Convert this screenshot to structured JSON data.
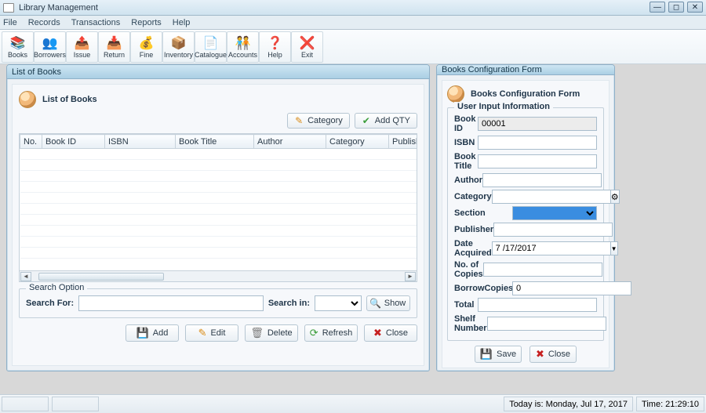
{
  "window": {
    "title": "Library Management"
  },
  "menu": [
    "File",
    "Records",
    "Transactions",
    "Reports",
    "Help"
  ],
  "toolbar": [
    {
      "label": "Books",
      "icon": "📚"
    },
    {
      "label": "Borrowers",
      "icon": "👥"
    },
    {
      "label": "Issue",
      "icon": "📤"
    },
    {
      "label": "Return",
      "icon": "📥"
    },
    {
      "label": "Fine",
      "icon": "💰"
    },
    {
      "label": "Inventory",
      "icon": "📦"
    },
    {
      "label": "Catalogue",
      "icon": "📄"
    },
    {
      "label": "Accounts",
      "icon": "🧑‍🤝‍🧑"
    },
    {
      "label": "Help",
      "icon": "❓"
    },
    {
      "label": "Exit",
      "icon": "❌"
    }
  ],
  "left_panel": {
    "mdi_title": "List of Books",
    "header": "List of Books",
    "btn_category": "Category",
    "btn_addqty": "Add QTY",
    "columns": [
      "No.",
      "Book ID",
      "ISBN",
      "Book Title",
      "Author",
      "Category",
      "Publisher"
    ],
    "rows": [],
    "search_group": "Search Option",
    "search_for": "Search For:",
    "search_in": "Search in:",
    "btn_show": "Show",
    "actions": {
      "add": "Add",
      "edit": "Edit",
      "delete": "Delete",
      "refresh": "Refresh",
      "close": "Close"
    }
  },
  "right_panel": {
    "mdi_title": "Books Configuration Form",
    "header": "Books Configuration Form",
    "group": "User Input Information",
    "fields": {
      "book_id": {
        "label": "Book ID",
        "value": "00001"
      },
      "isbn": {
        "label": "ISBN",
        "value": ""
      },
      "book_title": {
        "label": "Book Title",
        "value": ""
      },
      "author": {
        "label": "Author",
        "value": ""
      },
      "category": {
        "label": "Category",
        "value": ""
      },
      "section": {
        "label": "Section",
        "value": ""
      },
      "publisher": {
        "label": "Publisher",
        "value": ""
      },
      "date_acquired": {
        "label": "Date Acquired",
        "value": "7 /17/2017"
      },
      "copies": {
        "label": "No. of Copies",
        "value": ""
      },
      "borrow_copies": {
        "label": "BorrowCopies",
        "value": "0"
      },
      "total": {
        "label": "Total",
        "value": ""
      },
      "shelf": {
        "label": "Shelf Number",
        "value": ""
      }
    },
    "actions": {
      "save": "Save",
      "close": "Close"
    }
  },
  "status": {
    "today": "Today is: Monday, Jul 17, 2017",
    "time": "Time: 21:29:10"
  }
}
